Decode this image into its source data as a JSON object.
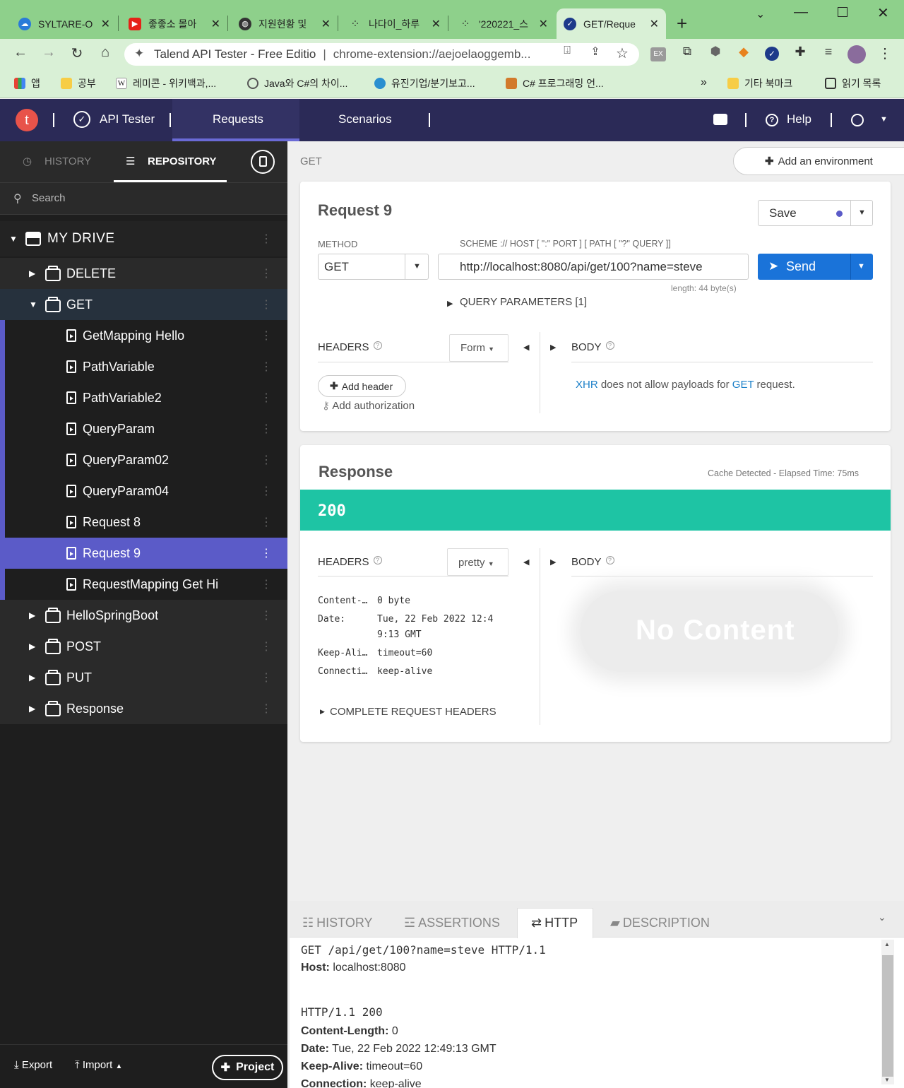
{
  "browser": {
    "tabs": [
      {
        "title": "SYLTARE-O",
        "favicon": "cloud-icon",
        "color": "#2a7bd8"
      },
      {
        "title": "좋좋소 몰아",
        "favicon": "youtube-icon",
        "color": "#e62117"
      },
      {
        "title": "지원현황 및",
        "favicon": "globe-icon",
        "color": "#333333"
      },
      {
        "title": "나다이_하루",
        "favicon": "nodes-icon",
        "color": "#333333"
      },
      {
        "title": "'220221_스",
        "favicon": "nodes-icon",
        "color": "#333333"
      },
      {
        "title": "GET/Reque",
        "favicon": "check-circle-icon",
        "color": "#1d3a8a"
      }
    ],
    "new_tab": "+",
    "address": {
      "site": "Talend API Tester - Free Editio",
      "url": "chrome-extension://aejoelaoggemb..."
    },
    "bookmarks": [
      {
        "label": "앱",
        "icon": "apps-grid-icon"
      },
      {
        "label": "공부",
        "icon": "folder-icon"
      },
      {
        "label": "레미콘 - 위키백과,...",
        "icon": "wikipedia-icon"
      },
      {
        "label": "Java와 C#의 차이...",
        "icon": "link-icon"
      },
      {
        "label": "유진기업/분기보고...",
        "icon": "site-icon"
      },
      {
        "label": "C# 프로그래밍 언...",
        "icon": "site-icon"
      }
    ],
    "bookmarks_more": "»",
    "bookmarks_right": [
      {
        "label": "기타 북마크",
        "icon": "folder-icon"
      },
      {
        "label": "읽기 목록",
        "icon": "reading-list-icon"
      }
    ]
  },
  "app": {
    "logo": "t",
    "product": "API Tester",
    "nav": [
      "Requests",
      "Scenarios"
    ],
    "help": "Help"
  },
  "sidebar": {
    "tabs": [
      "HISTORY",
      "REPOSITORY"
    ],
    "search_placeholder": "Search",
    "drive": "MY DRIVE",
    "folders_top": [
      "DELETE",
      "GET"
    ],
    "get_items": [
      "GetMapping Hello",
      "PathVariable",
      "PathVariable2",
      "QueryParam",
      "QueryParam02",
      "QueryParam04",
      "Request 8",
      "Request 9",
      "RequestMapping Get Hi"
    ],
    "selected_item": "Request 9",
    "folders_bottom": [
      "HelloSpringBoot",
      "POST",
      "PUT",
      "Response"
    ],
    "footer": {
      "export": "Export",
      "import": "Import",
      "project": "Project"
    }
  },
  "main": {
    "breadcrumb": "GET",
    "add_environment": "Add an environment",
    "request": {
      "title": "Request 9",
      "save": "Save",
      "method_label": "METHOD",
      "method": "GET",
      "url_label": "SCHEME :// HOST [ \":\" PORT ] [ PATH [ \"?\" QUERY ]]",
      "url": "http://localhost:8080/api/get/100?name=steve",
      "length": "length: 44 byte(s)",
      "send": "Send",
      "query_params": "QUERY PARAMETERS [1]",
      "headers_label": "HEADERS",
      "headers_mode": "Form",
      "body_label": "BODY",
      "add_header": "Add header",
      "add_authorization": "Add authorization",
      "body_note": {
        "a": "XHR",
        "b": " does not allow payloads for ",
        "c": "GET",
        "d": " request."
      }
    },
    "response": {
      "title": "Response",
      "meta": "Cache Detected - Elapsed Time: 75ms",
      "status": "200",
      "status_color": "#1ec4a4",
      "headers_label": "HEADERS",
      "headers_mode": "pretty",
      "body_label": "BODY",
      "headers": [
        {
          "k": "Content-…",
          "v": "0 byte"
        },
        {
          "k": "Date:",
          "v": "Tue, 22 Feb 2022 12:4"
        },
        {
          "k": "",
          "v": "9:13 GMT"
        },
        {
          "k": "Keep-Ali…",
          "v": "timeout=60"
        },
        {
          "k": "Connecti…",
          "v": "keep-alive"
        }
      ],
      "complete_headers": "COMPLETE REQUEST HEADERS",
      "no_content": "No Content"
    },
    "bottom": {
      "tabs": [
        "HISTORY",
        "ASSERTIONS",
        "HTTP",
        "DESCRIPTION"
      ],
      "active_tab": "HTTP",
      "request_line": "GET /api/get/100?name=steve HTTP/1.1",
      "host_k": "Host:",
      "host_v": " localhost:8080",
      "status_line": "HTTP/1.1 200",
      "lines": [
        {
          "k": "Content-Length:",
          "v": " 0"
        },
        {
          "k": "Date:",
          "v": " Tue, 22 Feb 2022 12:49:13 GMT"
        },
        {
          "k": "Keep-Alive:",
          "v": " timeout=60"
        },
        {
          "k": "Connection:",
          "v": " keep-alive"
        }
      ]
    }
  }
}
